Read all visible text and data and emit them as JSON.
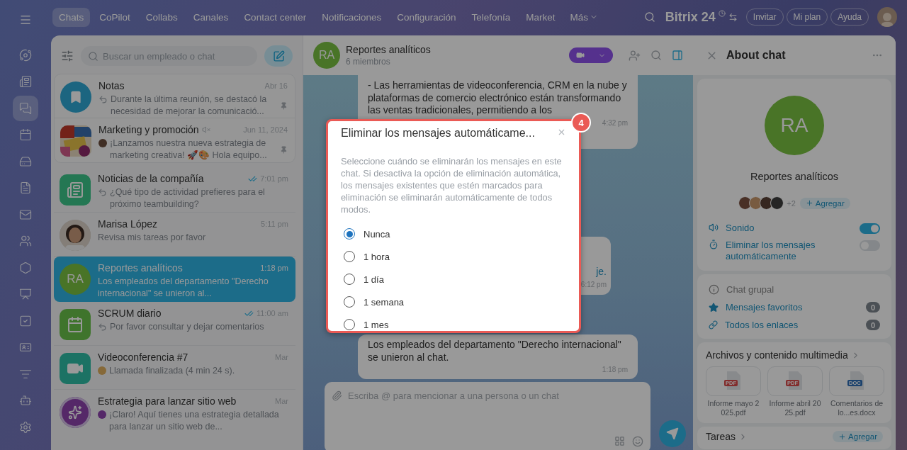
{
  "rail": [
    {
      "kind": "orbit",
      "selected": false
    },
    {
      "kind": "news",
      "selected": false
    },
    {
      "kind": "chats",
      "selected": true
    },
    {
      "kind": "calendar",
      "selected": false
    },
    {
      "kind": "drive",
      "selected": false
    },
    {
      "kind": "doc",
      "selected": false
    },
    {
      "kind": "mail",
      "selected": false
    },
    {
      "kind": "users",
      "selected": false
    },
    {
      "kind": "hexagon",
      "selected": false
    },
    {
      "kind": "board",
      "selected": false
    },
    {
      "kind": "task",
      "selected": false
    },
    {
      "kind": "card",
      "selected": false
    },
    {
      "kind": "funnel",
      "selected": false
    },
    {
      "kind": "bot",
      "selected": false
    },
    {
      "kind": "settings",
      "selected": false
    }
  ],
  "nav": {
    "items": [
      {
        "label": "Chats",
        "selected": true
      },
      {
        "label": "CoPilot",
        "selected": false
      },
      {
        "label": "Collabs",
        "selected": false
      },
      {
        "label": "Canales",
        "selected": false
      },
      {
        "label": "Contact center",
        "selected": false
      },
      {
        "label": "Notificaciones",
        "selected": false
      },
      {
        "label": "Configuración",
        "selected": false
      },
      {
        "label": "Telefonía",
        "selected": false
      },
      {
        "label": "Market",
        "selected": false
      }
    ],
    "more": "Más",
    "logo": "Bitrix 24",
    "buttons": [
      "Invitar",
      "Mi plan",
      "Ayuda"
    ]
  },
  "chat_list": {
    "search": {
      "placeholder": "Buscar un empleado o chat"
    },
    "items": [
      {
        "name": "Notas",
        "time": "Abr 16",
        "preview": "Durante la última reunión, se destacó la necesidad de mejorar la comunicació...",
        "avatar": {
          "kind": "bookmark"
        },
        "prefix": {
          "kind": "reply"
        },
        "pinned": true,
        "muted": false,
        "read": false,
        "selected": false
      },
      {
        "name": "Marketing y promoción",
        "time": "Jun 11, 2024",
        "preview": "¡Lanzamos nuestra nueva estrategia de marketing creativa! 🚀🎨 Hola equipo...",
        "prefix": {
          "kind": "person"
        },
        "pinned": true,
        "muted": true,
        "read": false,
        "selected": false
      },
      {
        "name": "Noticias de la compañía",
        "time": "7:01 pm",
        "preview": "¿Qué tipo de actividad prefieres para el próximo teambuilding?",
        "avatar": {
          "kind": "news"
        },
        "prefix": {
          "kind": "reply"
        },
        "pinned": false,
        "muted": false,
        "read": true,
        "selected": false
      },
      {
        "name": "Marisa López",
        "time": "5:11 pm",
        "preview": "Revisa mis tareas por favor",
        "pinned": false,
        "muted": false,
        "read": false,
        "selected": false
      },
      {
        "name": "Reportes analíticos",
        "time": "1:18 pm",
        "preview": "Los empleados del departamento \"Derecho internacional\" se unieron al...",
        "avatar": {
          "kind": "initials",
          "text": "RA"
        },
        "pinned": false,
        "muted": false,
        "read": false,
        "selected": true
      },
      {
        "name": "SCRUM diario",
        "time": "11:00 am",
        "preview": "Por favor consultar y dejar comentarios",
        "avatar": {
          "kind": "calendar"
        },
        "prefix": {
          "kind": "reply"
        },
        "pinned": false,
        "muted": false,
        "read": true,
        "selected": false
      },
      {
        "name": "Videoconferencia #7",
        "time": "Mar",
        "preview": "Llamada finalizada (4 min 24 s).",
        "avatar": {
          "kind": "video"
        },
        "prefix": {
          "kind": "call"
        },
        "pinned": false,
        "muted": false,
        "read": false,
        "selected": false
      },
      {
        "name": "Estrategia para lanzar sitio web",
        "time": "Mar",
        "preview": "¡Claro! Aquí tienes una estrategia detallada para lanzar un sitio web de...",
        "avatar": {
          "kind": "copilot"
        },
        "prefix": {
          "kind": "bot"
        },
        "pinned": false,
        "muted": false,
        "read": false,
        "selected": false
      }
    ]
  },
  "chat": {
    "header": {
      "initials": "RA",
      "title": "Reportes analíticos",
      "subtitle": "6 miembros"
    },
    "messages": [
      {
        "kind": "text",
        "text": "- Las herramientas de videoconferencia, CRM en la nube y plataformas de comercio electrónico están transformando las ventas tradicionales, permitiendo a los",
        "time": "4:32 pm"
      },
      {
        "kind": "hidden",
        "text": "je.",
        "time": "6:12 pm"
      },
      {
        "kind": "text",
        "text": "Los empleados del departamento \"Derecho internacional\" se unieron al chat.",
        "time": "1:18 pm"
      }
    ],
    "composer": {
      "placeholder": "Escriba @ para mencionar a una persona o un chat"
    }
  },
  "modal": {
    "badge": "4",
    "title": "Eliminar los mensajes automáticame...",
    "description": "Seleccione cuándo se eliminarán los mensajes en este chat. Si desactiva la opción de eliminación automática, los mensajes existentes que estén marcados para eliminación se eliminarán automáticamente de todos modos.",
    "options": [
      {
        "label": "Nunca",
        "selected": true
      },
      {
        "label": "1 hora",
        "selected": false
      },
      {
        "label": "1 día",
        "selected": false
      },
      {
        "label": "1 semana",
        "selected": false
      },
      {
        "label": "1 mes",
        "selected": false
      }
    ]
  },
  "about": {
    "title": "About chat",
    "initials": "RA",
    "name": "Reportes analíticos",
    "more_members": "+2",
    "add": "Agregar",
    "settings": [
      {
        "kind": "sound",
        "label": "Sonido",
        "on": true
      },
      {
        "kind": "timer",
        "label": "Eliminar los mensajes automáticamente",
        "on": false
      }
    ],
    "info": "Chat grupal",
    "links": [
      {
        "kind": "star",
        "label": "Mensajes favoritos",
        "count": "0"
      },
      {
        "kind": "link",
        "label": "Todos los enlaces",
        "count": "0"
      }
    ],
    "files_title": "Archivos y contenido multimedia",
    "files": [
      {
        "kind": "pdf",
        "type": "PDF",
        "name": "Informe mayo 2025.pdf"
      },
      {
        "kind": "pdf",
        "type": "PDF",
        "name": "Informe abril 2025.pdf"
      },
      {
        "kind": "doc",
        "type": "DOC",
        "name": "Comentarios de lo...es.docx"
      }
    ],
    "tasks_title": "Tareas",
    "tasks_add": "Agregar"
  }
}
